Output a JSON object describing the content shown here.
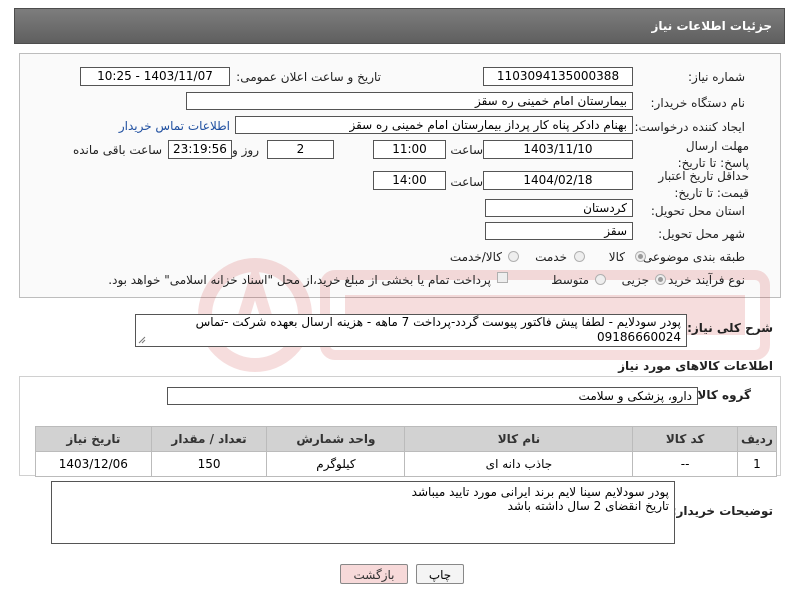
{
  "header": {
    "title": "جزئیات اطلاعات نیاز"
  },
  "fields": {
    "need_number_label": "شماره نیاز:",
    "need_number": "1103094135000388",
    "announce_label": "تاریخ و ساعت اعلان عمومی:",
    "announce_value": "1403/11/07 - 10:25",
    "buyer_label": "نام دستگاه خریدار:",
    "buyer_value": "بیمارستان امام خمینی  ره  سقز",
    "creator_label": "ایجاد کننده درخواست:",
    "creator_value": "بهنام دادکر پناه کار پرداز بیمارستان امام خمینی  ره  سقز",
    "contact_link": "اطلاعات تماس خریدار",
    "deadline_label": "مهلت ارسال پاسخ: تا تاریخ:",
    "deadline_date": "1403/11/10",
    "hour_label": "ساعت",
    "deadline_time": "11:00",
    "days_value": "2",
    "days_label": "روز و",
    "remaining_value": "23:19:56",
    "remaining_label": "ساعت باقی مانده",
    "validity_label": "حداقل تاریخ اعتبار قیمت: تا تاریخ:",
    "validity_date": "1404/02/18",
    "validity_time": "14:00",
    "province_label": "استان محل تحویل:",
    "province_value": "کردستان",
    "city_label": "شهر محل تحویل:",
    "city_value": "سقز",
    "category_label": "طبقه بندی موضوعی:",
    "category_opt1": "کالا",
    "category_opt2": "خدمت",
    "category_opt3": "کالا/خدمت",
    "process_label": "نوع فرآیند خرید :",
    "process_opt1": "جزیی",
    "process_opt2": "متوسط",
    "process_note": "پرداخت تمام یا بخشی از مبلغ خرید،از محل \"اسناد خزانه اسلامی\" خواهد بود."
  },
  "description": {
    "label": "شرح کلی نیاز:",
    "text_line1": "پودر سودلایم  - لطفا پیش فاکتور پیوست گردد-پرداخت 7 ماهه - هزینه ارسال بعهده شرکت -تماس",
    "text_line2": "09186660024"
  },
  "goods": {
    "section_title": "اطلاعات کالاهای مورد نیاز",
    "group_label": "گروه کالا:",
    "group_value": "دارو، پزشکی و سلامت",
    "columns": [
      "ردیف",
      "کد کالا",
      "نام کالا",
      "واحد شمارش",
      "تعداد / مقدار",
      "تاریخ نیاز"
    ],
    "rows": [
      {
        "row": "1",
        "code": "--",
        "name": "جاذب دانه ای",
        "unit": "کیلوگرم",
        "qty": "150",
        "date": "1403/12/06"
      }
    ]
  },
  "buyer_notes": {
    "label": "توضیحات خریدار:",
    "line1": "پودر سودلایم سینا لایم  برند ایرانی  مورد تایید میباشد",
    "line2": "تاریخ انقضای 2 سال داشته باشد"
  },
  "buttons": {
    "print": "چاپ",
    "back": "بازگشت"
  },
  "colors": {
    "header_bg": "#6e6e6e",
    "link": "#1f4fa0",
    "back_button": "#f7d9d9"
  }
}
